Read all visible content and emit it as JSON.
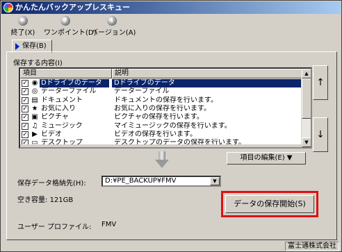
{
  "window": {
    "title": "かんたんバックアップレスキュー"
  },
  "toolbar": {
    "exit_label": "終了(X)",
    "onepoint_label": "ワンポイント(D)",
    "version_label": "バージョン(A)"
  },
  "tabs": {
    "save_label": "保存(B)"
  },
  "content_section": {
    "label": "保存する内容(I)",
    "columns": {
      "item": "項目",
      "description": "説明"
    },
    "rows": [
      {
        "checked": true,
        "icon": "d-drive-icon",
        "item": "Dドライブのデータ",
        "description": "Dドライブのデータ",
        "selected": true
      },
      {
        "checked": true,
        "icon": "data-file-icon",
        "item": "データーファイル",
        "description": "データーファイル"
      },
      {
        "checked": true,
        "icon": "document-icon",
        "item": "ドキュメント",
        "description": "ドキュメントの保存を行います。"
      },
      {
        "checked": true,
        "icon": "favorites-icon",
        "item": "お気に入り",
        "description": "お気に入りの保存を行います。"
      },
      {
        "checked": true,
        "icon": "pictures-icon",
        "item": "ピクチャ",
        "description": "ピクチャの保存を行います。"
      },
      {
        "checked": true,
        "icon": "music-icon",
        "item": "ミュージック",
        "description": "マイミュージックの保存を行います。"
      },
      {
        "checked": true,
        "icon": "video-icon",
        "item": "ビデオ",
        "description": "ビデオの保存を行います。"
      },
      {
        "checked": true,
        "icon": "desktop-icon",
        "item": "デスクトップ",
        "description": "デスクトップのデータの保存を行います。"
      }
    ],
    "scroll_up": "↑",
    "scroll_down": "↓",
    "edit_button": "項目の編集(E) ▼"
  },
  "destination": {
    "label": "保存データ格納先(H):",
    "value": "D:¥PE_BACKUP¥FMV"
  },
  "free_space": {
    "label": "空き容量:",
    "value": "121GB"
  },
  "start_button": {
    "label": "データの保存開始(S)"
  },
  "profile": {
    "label": "ユーザー プロファイル:",
    "value": "FMV"
  },
  "status": {
    "company": "富士通株式会社"
  },
  "colors": {
    "selection": "#0a246a",
    "highlight_border": "#e01010",
    "titlebar_start": "#0a246a"
  }
}
